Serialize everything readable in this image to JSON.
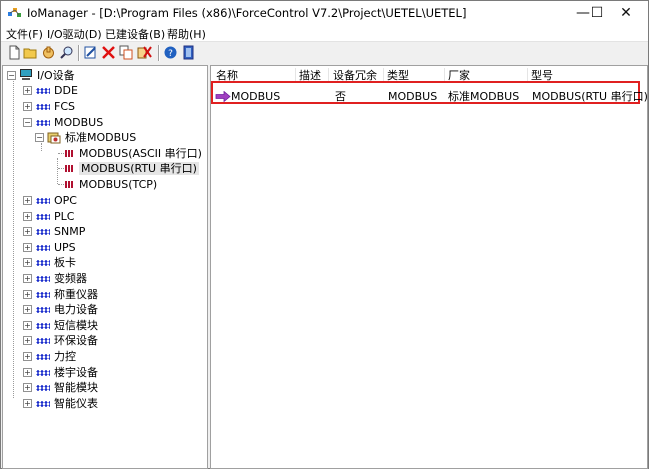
{
  "window": {
    "title": "IoManager - [D:\\Program Files (x86)\\ForceControl V7.2\\Project\\UETEL\\UETEL]",
    "controls": {
      "minimize": "—",
      "maximize": "☐",
      "close": "✕"
    }
  },
  "menu": [
    "文件(F)",
    "I/O驱动(D)",
    "已建设备(B)",
    "帮助(H)"
  ],
  "toolbar": [
    "new-icon",
    "open-icon",
    "hand-icon",
    "find-icon",
    "edit-icon",
    "delete-icon",
    "copy-icon",
    "cut-icon",
    "help-icon",
    "exit-icon"
  ],
  "tree": {
    "root": "I/O设备",
    "items": [
      "DDE",
      "FCS",
      "MODBUS",
      "OPC",
      "PLC",
      "SNMP",
      "UPS",
      "板卡",
      "变频器",
      "称重仪器",
      "电力设备",
      "短信模块",
      "环保设备",
      "力控",
      "楼宇设备",
      "智能模块",
      "智能仪表"
    ],
    "modbus_group": "标准MODBUS",
    "modbus_children": [
      "MODBUS(ASCII 串行口)",
      "MODBUS(RTU 串行口)",
      "MODBUS(TCP)"
    ],
    "selected": "MODBUS(RTU 串行口)"
  },
  "list": {
    "columns": [
      "名称",
      "描述",
      "设备冗余",
      "类型",
      "厂家",
      "型号"
    ],
    "rows": [
      {
        "name": "MODBUS",
        "desc": "",
        "redundant": "否",
        "type": "MODBUS",
        "vendor": "标准MODBUS",
        "model": "MODBUS(RTU 串行口)"
      }
    ]
  },
  "colors": {
    "highlight_box": "#e02020",
    "tree_icon": "#1a2ccc",
    "arrow": "#9020b0"
  }
}
